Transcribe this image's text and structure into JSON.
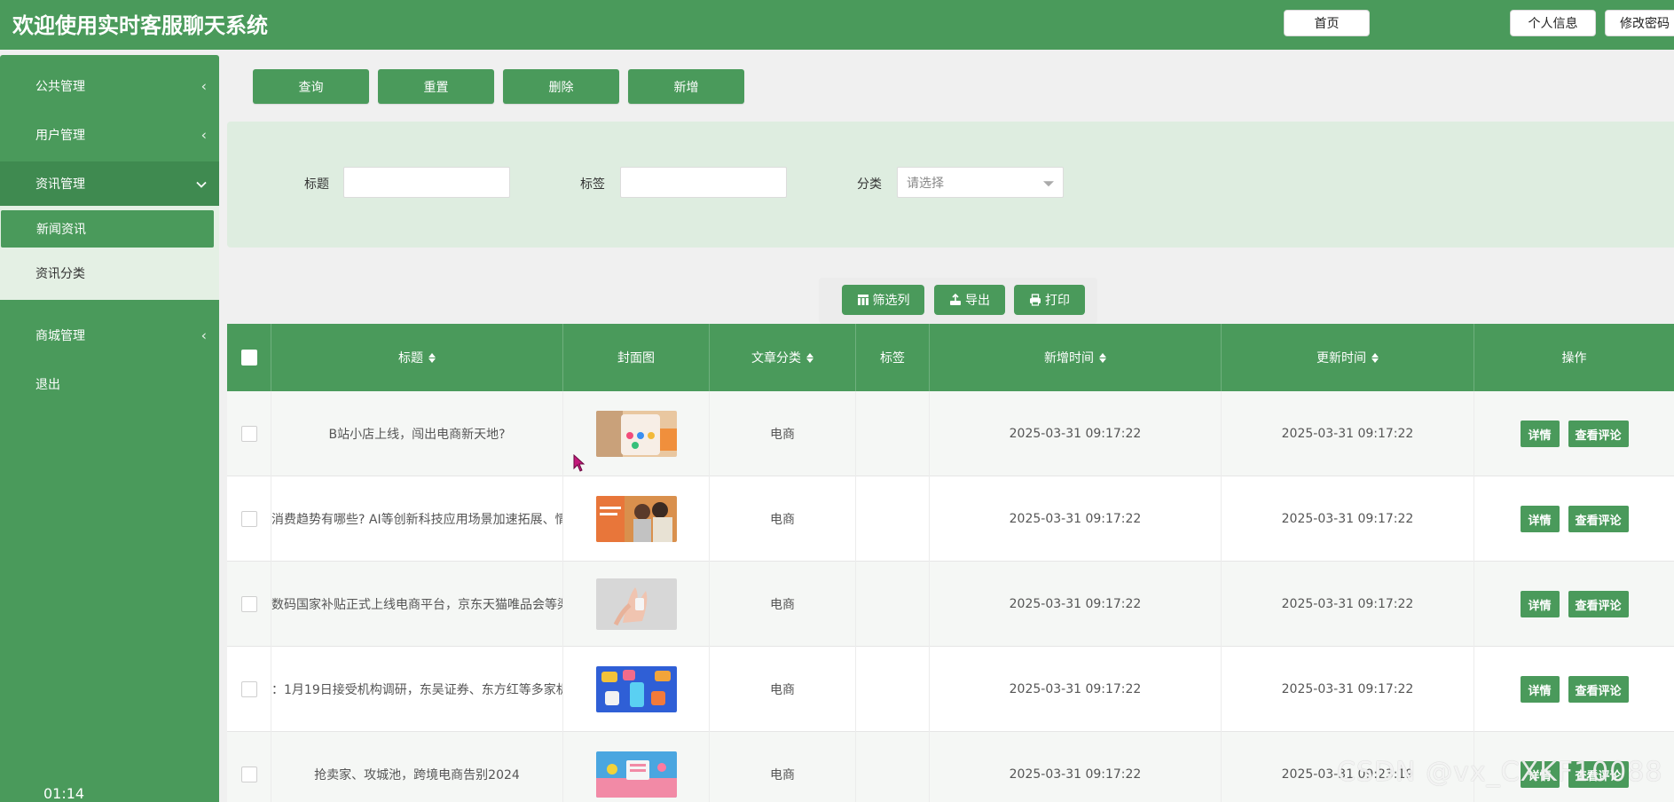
{
  "header": {
    "title": "欢迎使用实时客服聊天系统",
    "home_label": "首页",
    "profile_label": "个人信息",
    "change_password_label": "修改密码"
  },
  "sidebar": {
    "items": [
      {
        "label": "公共管理",
        "icon": "chevron-left-icon"
      },
      {
        "label": "用户管理",
        "icon": "chevron-left-icon"
      },
      {
        "label": "资讯管理",
        "icon": "chevron-down-icon"
      },
      {
        "label": "商城管理",
        "icon": "chevron-left-icon"
      },
      {
        "label": "退出"
      }
    ],
    "submenu": [
      {
        "label": "新闻资讯",
        "selected": true
      },
      {
        "label": "资讯分类",
        "selected": false
      }
    ],
    "timer": "01:14"
  },
  "actions": {
    "query": "查询",
    "reset": "重置",
    "delete": "删除",
    "add": "新增"
  },
  "search": {
    "title_label": "标题",
    "title_value": "",
    "tag_label": "标签",
    "tag_value": "",
    "category_label": "分类",
    "category_placeholder": "请选择"
  },
  "toolbar": {
    "filter_columns": "筛选列",
    "export": "导出",
    "print": "打印"
  },
  "table": {
    "columns": [
      "标题",
      "封面图",
      "文章分类",
      "标签",
      "新增时间",
      "更新时间",
      "操作"
    ],
    "rows": [
      {
        "title": "B站小店上线，闯出电商新天地?",
        "category": "电商",
        "tag": "",
        "created": "2025-03-31 09:17:22",
        "updated": "2025-03-31 09:17:22",
        "thumb": "phone-apps"
      },
      {
        "title": "消费趋势有哪些? AI等创新科技应用场景加速拓展、情",
        "category": "电商",
        "tag": "",
        "created": "2025-03-31 09:17:22",
        "updated": "2025-03-31 09:17:22",
        "thumb": "couple"
      },
      {
        "title": "数码国家补贴正式上线电商平台，京东天猫唯品会等渠",
        "category": "电商",
        "tag": "",
        "created": "2025-03-31 09:17:22",
        "updated": "2025-03-31 09:17:22",
        "thumb": "hands"
      },
      {
        "title": "：1月19日接受机构调研，东吴证券、东方红等多家机",
        "category": "电商",
        "tag": "",
        "created": "2025-03-31 09:17:22",
        "updated": "2025-03-31 09:17:22",
        "thumb": "blue-shopping"
      },
      {
        "title": "抢卖家、攻城池，跨境电商告别2024",
        "category": "电商",
        "tag": "",
        "created": "2025-03-31 09:17:22",
        "updated": "2025-03-31 09:23:19",
        "thumb": "cart"
      }
    ],
    "detail_label": "详情",
    "comments_label": "查看评论"
  },
  "watermark": "CSDN @vx_CXKF10088",
  "colors": {
    "primary": "#4a9a5b",
    "panel": "#deede0",
    "background": "#f0f0f0"
  }
}
